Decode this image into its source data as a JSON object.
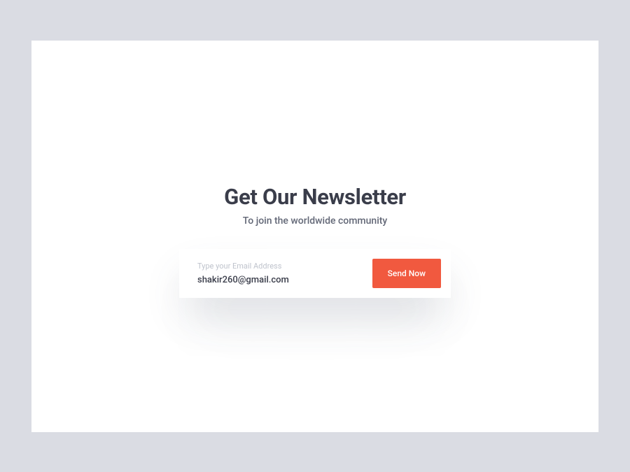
{
  "header": {
    "title": "Get Our Newsletter",
    "subtitle": "To join the worldwide community"
  },
  "form": {
    "email_placeholder": "Type your Email Address",
    "email_value": "shakir260@gmail.com",
    "submit_label": "Send Now"
  },
  "colors": {
    "accent": "#f1593f",
    "text_primary": "#3a3d4a",
    "text_secondary": "#636877",
    "placeholder": "#bfc3cc",
    "page_bg": "#dadce3",
    "card_bg": "#ffffff"
  }
}
